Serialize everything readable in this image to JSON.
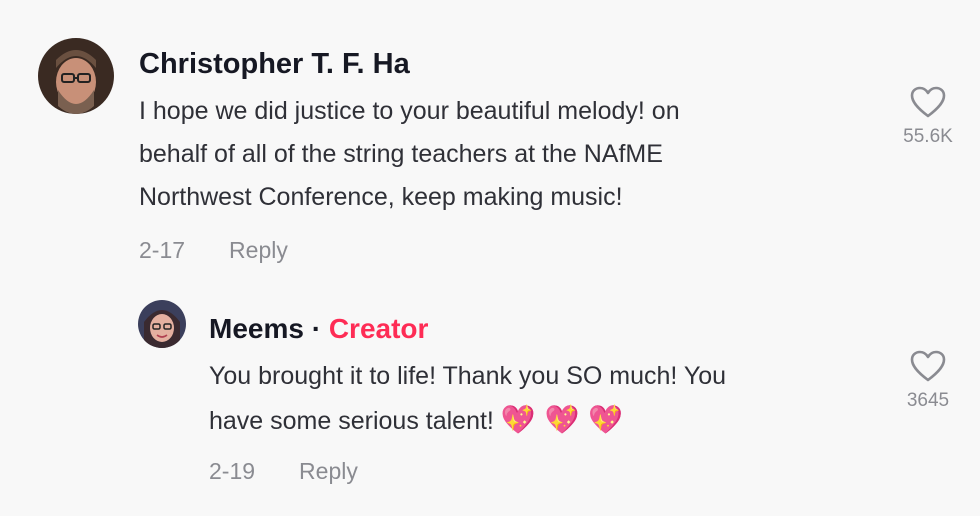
{
  "comments": [
    {
      "author": "Christopher T. F. Ha",
      "text_lines": [
        "I hope we did justice to your beautiful melody! on",
        "behalf of all of the string teachers at the NAfME",
        "Northwest Conference, keep making music!"
      ],
      "date": "2-17",
      "reply_label": "Reply",
      "like_count": "55.6K"
    },
    {
      "author": "Meems",
      "separator": "·",
      "badge": "Creator",
      "text_lines": [
        "You brought it to life! Thank you SO much! You",
        "have some serious talent!"
      ],
      "emojis": "💖 💖 💖",
      "date": "2-19",
      "reply_label": "Reply",
      "like_count": "3645"
    }
  ],
  "colors": {
    "background": "#f8f8f8",
    "creator_badge": "#fe2c55",
    "muted": "#8a8b91"
  },
  "icons": {
    "like": "heart-outline-icon"
  }
}
